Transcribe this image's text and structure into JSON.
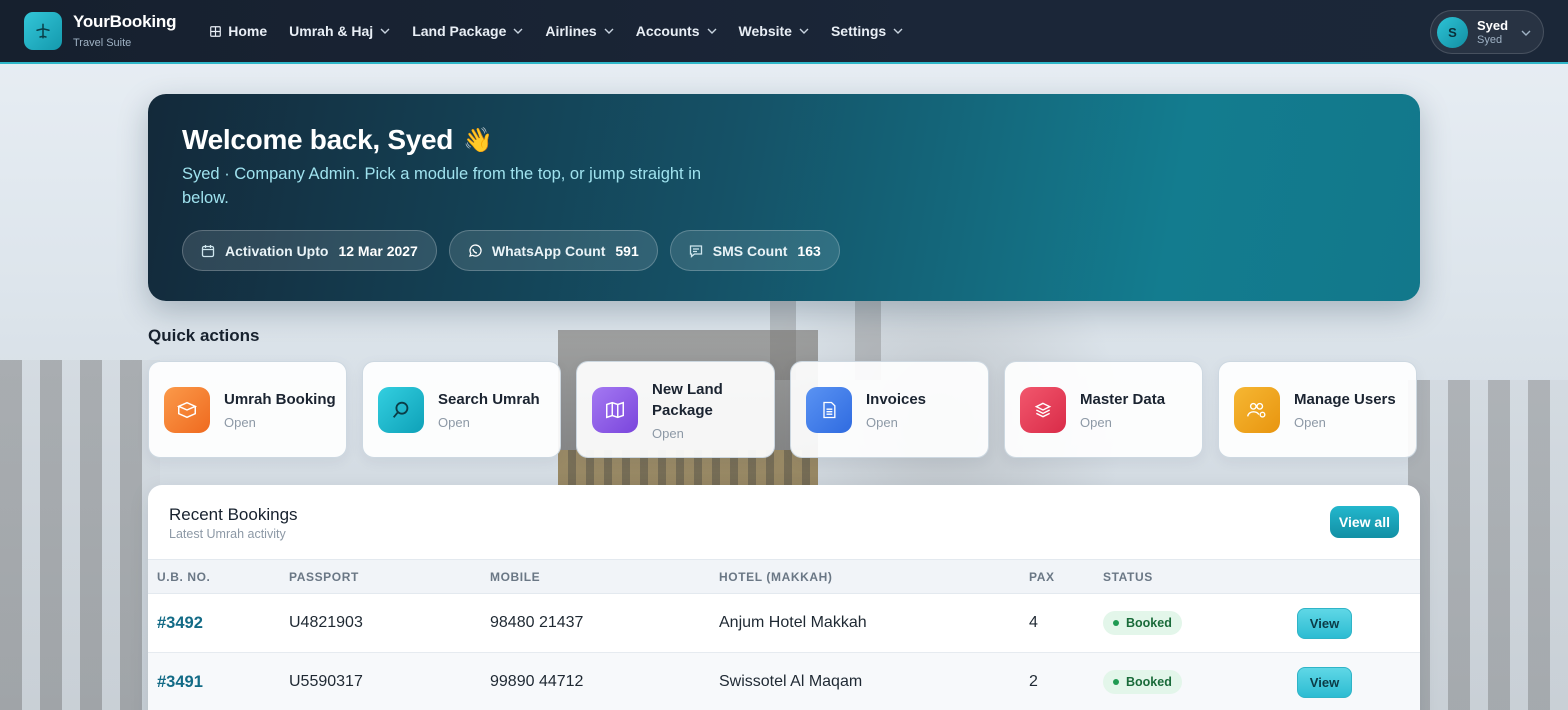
{
  "brand": {
    "name": "YourBooking",
    "subtitle": "Travel Suite"
  },
  "nav": {
    "items": [
      {
        "label": "Home",
        "has_dropdown": false,
        "icon": "grid-icon"
      },
      {
        "label": "Umrah & Haj",
        "has_dropdown": true
      },
      {
        "label": "Land Package",
        "has_dropdown": true
      },
      {
        "label": "Airlines",
        "has_dropdown": true
      },
      {
        "label": "Accounts",
        "has_dropdown": true
      },
      {
        "label": "Website",
        "has_dropdown": true
      },
      {
        "label": "Settings",
        "has_dropdown": true
      }
    ]
  },
  "user": {
    "initial": "S",
    "name": "Syed",
    "role": "Syed"
  },
  "hero": {
    "title": "Welcome back, Syed",
    "emoji": "👋",
    "subtitle": "Syed · Company Admin. Pick a module from the top, or jump straight in below.",
    "pills": [
      {
        "icon": "calendar-icon",
        "label": "Activation Upto",
        "value": "12 Mar 2027"
      },
      {
        "icon": "whatsapp-icon",
        "label": "WhatsApp Count",
        "value": "591"
      },
      {
        "icon": "message-icon",
        "label": "SMS Count",
        "value": "163"
      }
    ]
  },
  "quick_actions": {
    "title": "Quick actions",
    "items": [
      {
        "label": "Umrah Booking",
        "sub": "Open",
        "icon": "box-icon",
        "color": "#f47b2a"
      },
      {
        "label": "Search Umrah",
        "sub": "Open",
        "icon": "search-icon",
        "color": "#17b4c9"
      },
      {
        "label": "New Land Package",
        "sub": "Open",
        "icon": "map-icon",
        "color": "#8b54e6"
      },
      {
        "label": "Invoices",
        "sub": "Open",
        "icon": "document-icon",
        "color": "#3b7bea"
      },
      {
        "label": "Master Data",
        "sub": "Open",
        "icon": "layers-icon",
        "color": "#e63a55"
      },
      {
        "label": "Manage Users",
        "sub": "Open",
        "icon": "users-gear-icon",
        "color": "#eea11a"
      }
    ]
  },
  "recent_bookings": {
    "title": "Recent Bookings",
    "subtitle": "Latest Umrah activity",
    "view_all": "View all",
    "columns": [
      "U.B. NO.",
      "PASSPORT",
      "MOBILE",
      "HOTEL (MAKKAH)",
      "PAX",
      "STATUS",
      ""
    ],
    "rows": [
      {
        "ub": "#3492",
        "passport": "U4821903",
        "mobile": "98480 21437",
        "hotel": "Anjum Hotel Makkah",
        "pax": "4",
        "status": "Booked",
        "action": "View"
      },
      {
        "ub": "#3491",
        "passport": "U5590317",
        "mobile": "99890 44712",
        "hotel": "Swissotel Al Maqam",
        "pax": "2",
        "status": "Booked",
        "action": "View"
      }
    ]
  },
  "colors": {
    "accent": "#17b4c9",
    "nav_bg": "#16202e",
    "status_booked": "#1f9a52"
  }
}
